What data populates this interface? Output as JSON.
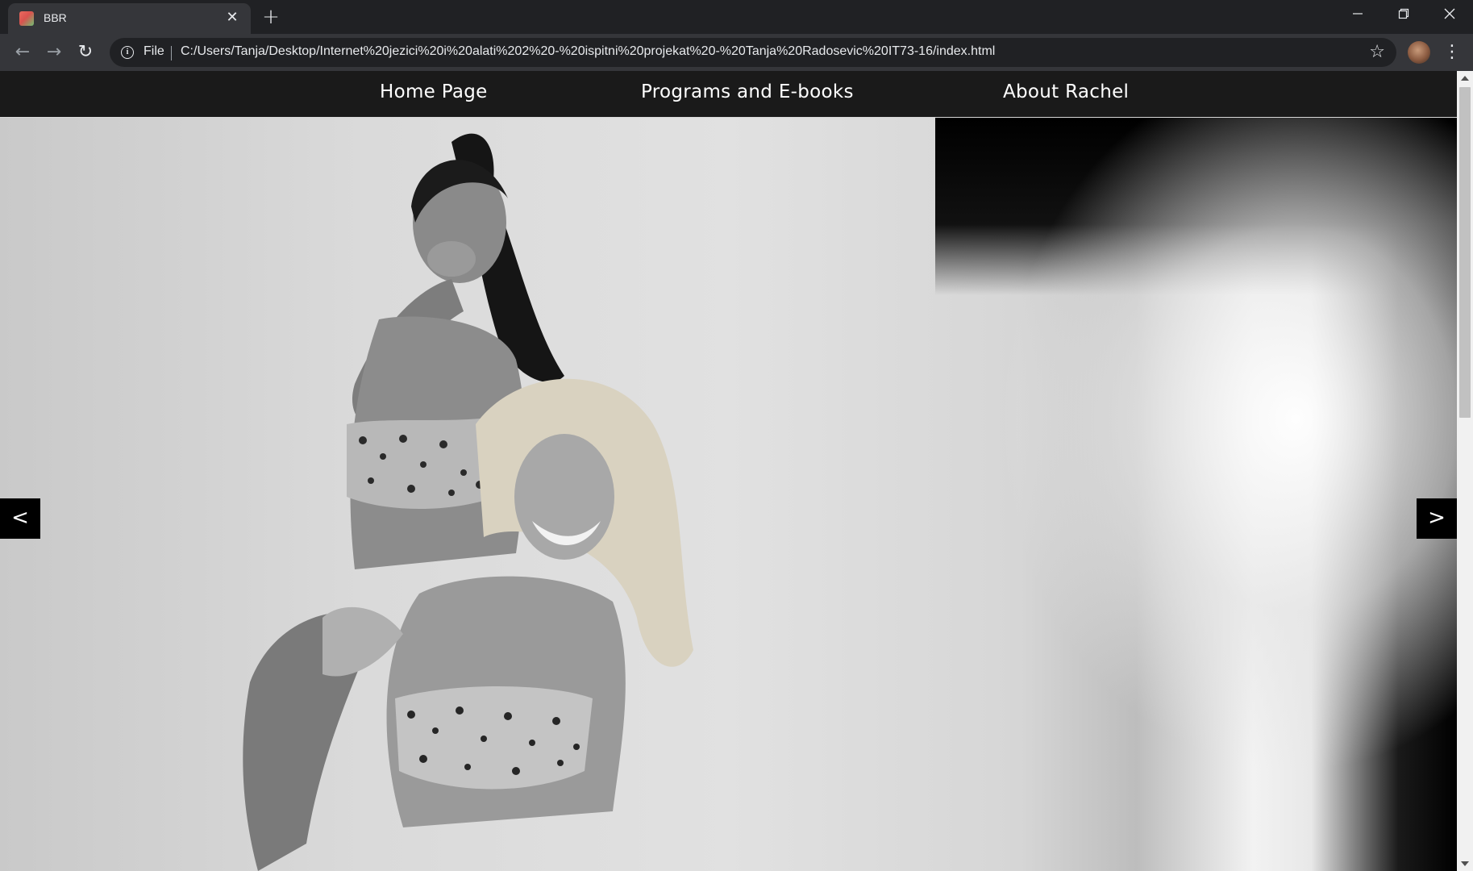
{
  "browser": {
    "tab_title": "BBR",
    "url_scheme": "File",
    "url": "C:/Users/Tanja/Desktop/Internet%20jezici%20i%20alati%202%20-%20ispitni%20projekat%20-%20Tanja%20Radosevic%20IT73-16/index.html",
    "window_controls": [
      "minimize-icon",
      "restore-icon",
      "close-icon"
    ]
  },
  "site_nav": {
    "items": [
      {
        "label": "Home Page"
      },
      {
        "label": "Programs and E-books"
      },
      {
        "label": "About Rachel"
      }
    ]
  },
  "slider": {
    "prev_label": "<",
    "next_label": ">"
  },
  "colors": {
    "chrome_dark": "#202124",
    "chrome_toolbar": "#35363a",
    "site_nav_bg": "#1a1a1a",
    "slider_button_bg": "#000000"
  }
}
